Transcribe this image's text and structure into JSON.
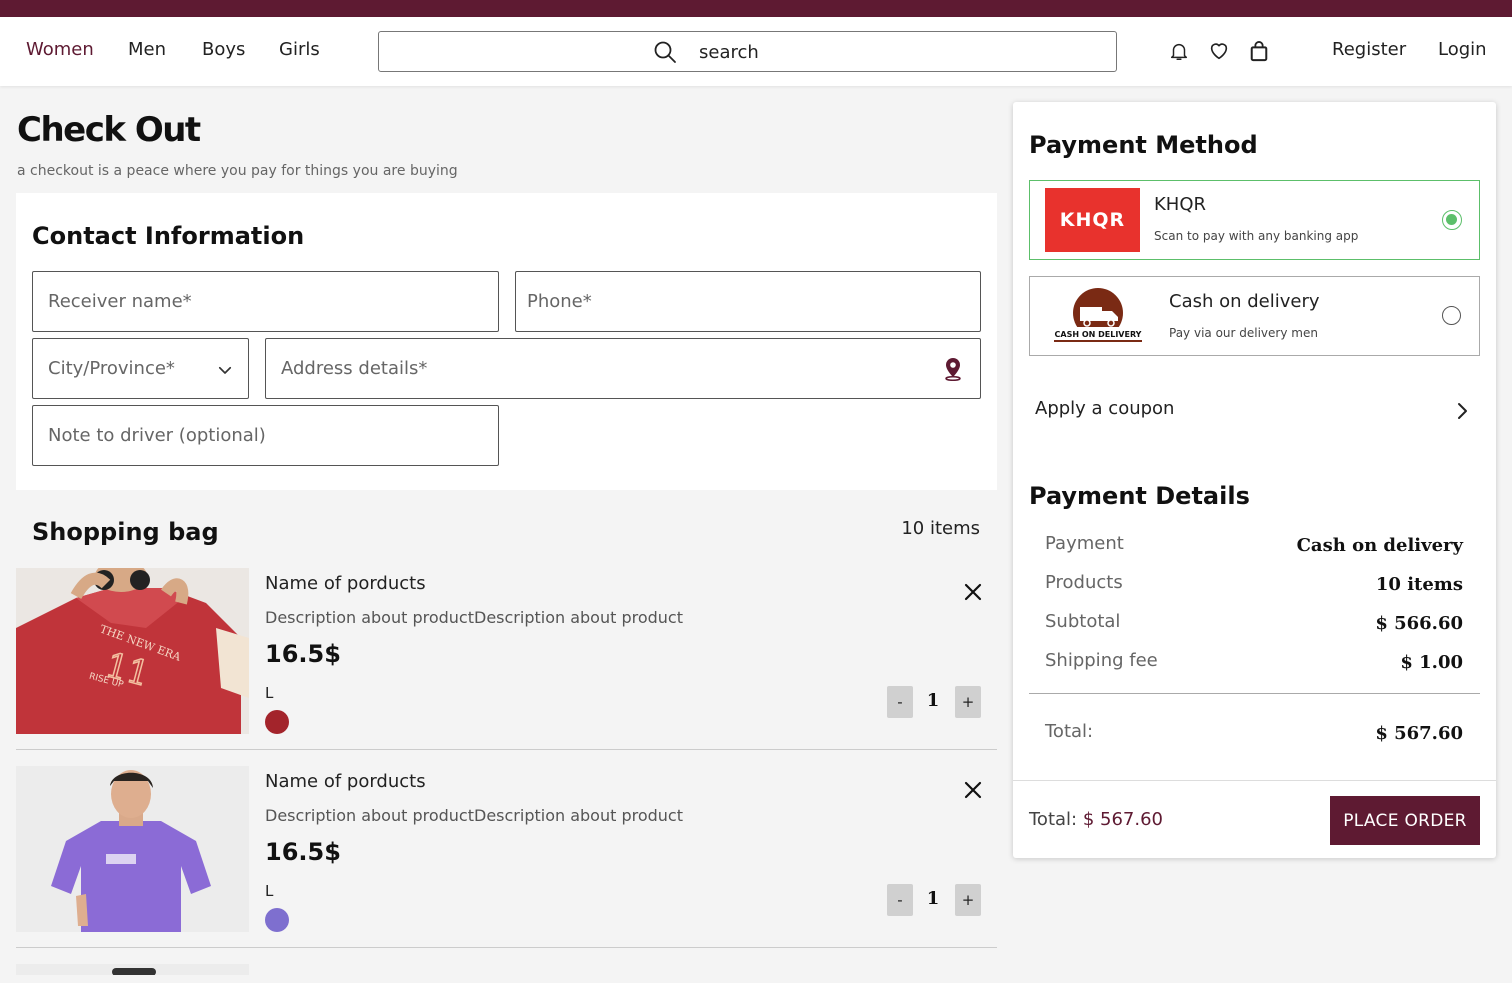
{
  "nav": {
    "links": [
      "Women",
      "Men",
      "Boys",
      "Girls"
    ],
    "active": "Women"
  },
  "search": {
    "placeholder": "search"
  },
  "header_icons": [
    "bell-icon",
    "heart-icon",
    "shopping-bag-icon"
  ],
  "auth": {
    "register": "Register",
    "login": "Login"
  },
  "page": {
    "title": "Check Out",
    "subtitle": "a checkout is a peace where you pay for things you are buying"
  },
  "contact": {
    "title": "Contact Information",
    "receiver_placeholder": "Receiver name*",
    "phone_placeholder": "Phone*",
    "city_placeholder": "City/Province*",
    "address_placeholder": "Address details*",
    "note_placeholder": "Note to driver (optional)"
  },
  "bag": {
    "title": "Shopping bag",
    "count": "10 items",
    "items": [
      {
        "name": "Name of porducts",
        "description": "Description about productDescription about product",
        "price": "16.5$",
        "size": "L",
        "color": "#a3242b",
        "qty": "1",
        "minus": "-",
        "plus": "+"
      },
      {
        "name": "Name of porducts",
        "description": "Description about productDescription about product",
        "price": "16.5$",
        "size": "L",
        "color": "#7e6fcf",
        "qty": "1",
        "minus": "-",
        "plus": "+"
      }
    ]
  },
  "payment": {
    "title": "Payment Method",
    "options": [
      {
        "logo_text": "KHQR",
        "name": "KHQR",
        "description": "Scan to pay with any banking app",
        "selected": true
      },
      {
        "logo_text": "CASH ON DELIVERY",
        "name": "Cash on delivery",
        "description": "Pay via our delivery men",
        "selected": false
      }
    ],
    "coupon_label": "Apply a coupon"
  },
  "details": {
    "title": "Payment Details",
    "rows": [
      {
        "label": "Payment",
        "value": "Cash on delivery"
      },
      {
        "label": "Products",
        "value": "10 items"
      },
      {
        "label": "Subtotal",
        "value": "$ 566.60"
      },
      {
        "label": "Shipping fee",
        "value": "$ 1.00"
      }
    ],
    "total_label": "Total:",
    "total_value": "$ 567.60"
  },
  "footer": {
    "total_label": "Total:",
    "total_value": "$ 567.60",
    "place_order": "PLACE ORDER"
  },
  "colors": {
    "brand": "#5e1a32",
    "khqr_red": "#e8322d",
    "selected_green": "#5cbf6a"
  }
}
